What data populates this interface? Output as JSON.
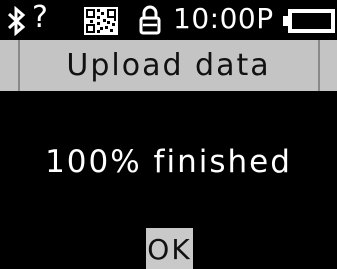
{
  "status_bar": {
    "icons": [
      "bluetooth-icon",
      "unknown-status-icon",
      "qr-code-icon",
      "lock-icon",
      "battery-icon"
    ],
    "unknown_symbol": "?",
    "time": "10:00P"
  },
  "dialog": {
    "title": "Upload data",
    "message": "100% finished",
    "ok_label": "OK"
  },
  "colors": {
    "background": "#000000",
    "bar": "#c4c4c4",
    "button": "#c9c9c9",
    "text_dark": "#111111",
    "text_light": "#ffffff"
  }
}
